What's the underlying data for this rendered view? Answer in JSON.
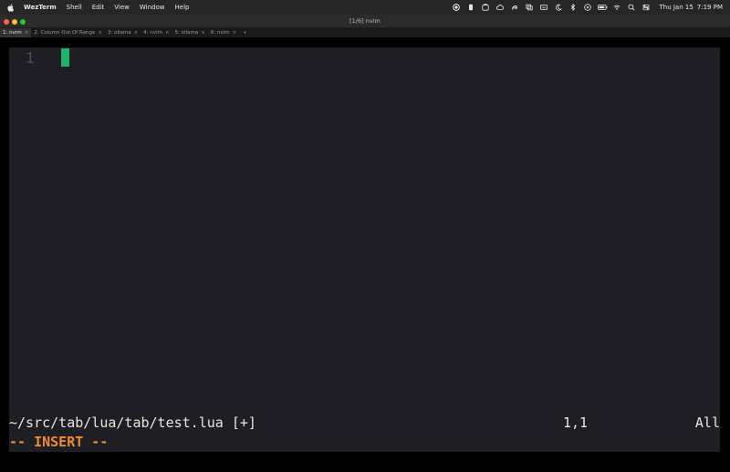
{
  "menubar": {
    "app_name": "WezTerm",
    "items": [
      "Shell",
      "Edit",
      "View",
      "Window",
      "Help"
    ],
    "status_icons": [
      "record-icon",
      "battery-indicator-icon",
      "dropbox-icon",
      "cloud-icon",
      "swirl-app-icon",
      "window-icon",
      "keyboard-icon",
      "moon-icon",
      "bluetooth-icon",
      "play-icon",
      "battery-icon",
      "wifi-icon",
      "search-icon",
      "control-center-icon"
    ],
    "date": "Thu Jan 15",
    "time": "7:19 PM"
  },
  "window": {
    "title": "[1/6] nvim"
  },
  "tabs": [
    {
      "label": "1: nvim",
      "active": true
    },
    {
      "label": "2: Column Out Of Range",
      "active": false
    },
    {
      "label": "3: ollama",
      "active": false
    },
    {
      "label": "4: nvim",
      "active": false
    },
    {
      "label": "5: ollama",
      "active": false
    },
    {
      "label": "6: nvim",
      "active": false
    }
  ],
  "tab_close_glyph": "×",
  "tab_new_glyph": "+",
  "editor": {
    "line_number": "1",
    "cursor_color": "#1fb26a"
  },
  "statusline": {
    "file": "~/src/tab/lua/tab/test.lua [+]",
    "position": "1,1",
    "scroll": "All"
  },
  "cmdline": {
    "mode": "-- INSERT --",
    "mode_color": "#f28c28"
  }
}
